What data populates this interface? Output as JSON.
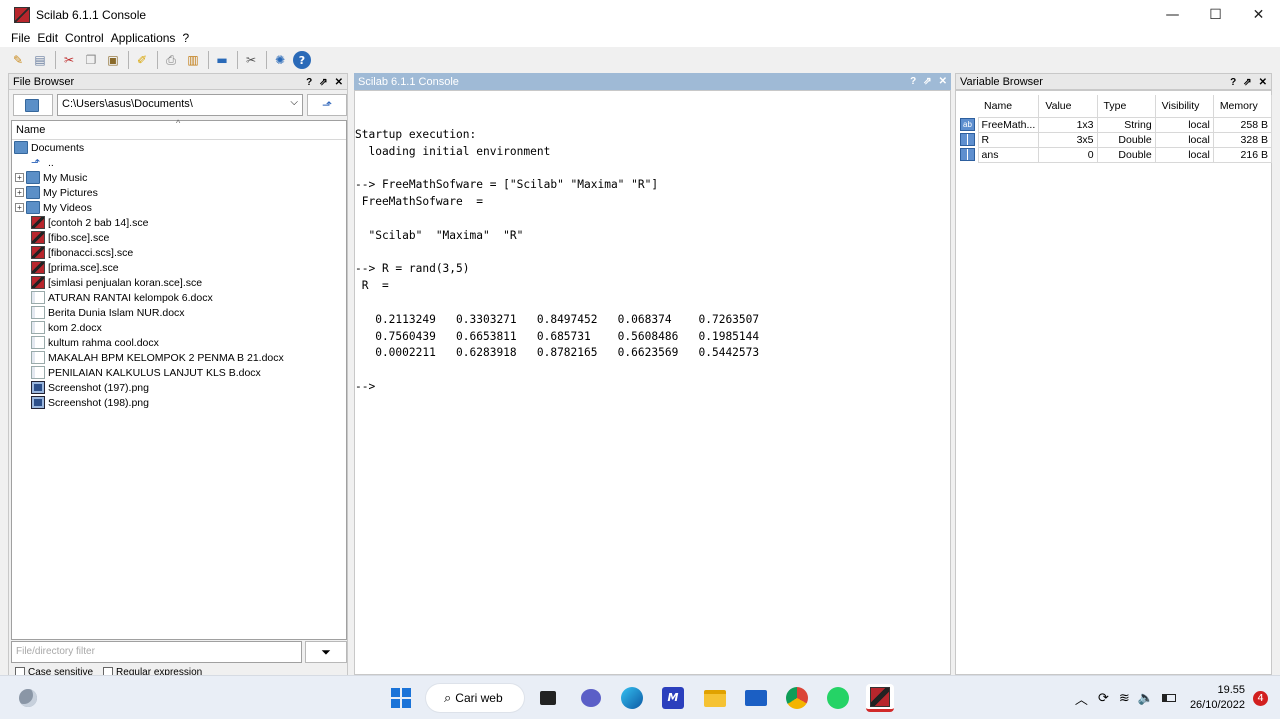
{
  "window": {
    "title": "Scilab 6.1.1 Console",
    "minimize": "—",
    "maximize": "☐",
    "close": "✕"
  },
  "menu": [
    "File",
    "Edit",
    "Control",
    "Applications",
    "?"
  ],
  "toolbar_icons": [
    "new-script-icon",
    "open-file-icon",
    "cut-icon",
    "copy-icon",
    "paste-icon",
    "clear-icon",
    "print-icon",
    "preferences-icon",
    "console-icon",
    "tools-icon",
    "modules-icon",
    "help-icon"
  ],
  "file_browser": {
    "title": "File Browser",
    "controls": [
      "?",
      "⇗",
      "✕"
    ],
    "path": "C:\\Users\\asus\\Documents\\",
    "column_name": "Name",
    "root": "Documents",
    "items": [
      {
        "label": "..",
        "type": "up",
        "expandable": false
      },
      {
        "label": "My Music",
        "type": "folder",
        "expandable": true
      },
      {
        "label": "My Pictures",
        "type": "folder",
        "expandable": true
      },
      {
        "label": "My Videos",
        "type": "folder",
        "expandable": true
      },
      {
        "label": "[contoh 2 bab 14].sce",
        "type": "sce",
        "expandable": false
      },
      {
        "label": "[fibo.sce].sce",
        "type": "sce",
        "expandable": false
      },
      {
        "label": "[fibonacci.scs].sce",
        "type": "sce",
        "expandable": false
      },
      {
        "label": "[prima.sce].sce",
        "type": "sce",
        "expandable": false
      },
      {
        "label": "[simlasi penjualan koran.sce].sce",
        "type": "sce",
        "expandable": false
      },
      {
        "label": "ATURAN RANTAI kelompok 6.docx",
        "type": "doc",
        "expandable": false
      },
      {
        "label": "Berita Dunia Islam NUR.docx",
        "type": "doc",
        "expandable": false
      },
      {
        "label": "kom 2.docx",
        "type": "doc",
        "expandable": false
      },
      {
        "label": "kultum rahma cool.docx",
        "type": "doc",
        "expandable": false
      },
      {
        "label": "MAKALAH BPM KELOMPOK 2 PENMA B 21.docx",
        "type": "doc",
        "expandable": false
      },
      {
        "label": "PENILAIAN KALKULUS LANJUT KLS B.docx",
        "type": "doc",
        "expandable": false
      },
      {
        "label": "Screenshot (197).png",
        "type": "png",
        "expandable": false
      },
      {
        "label": "Screenshot (198).png",
        "type": "png",
        "expandable": false
      }
    ],
    "filter_placeholder": "File/directory filter",
    "case_sensitive": "Case sensitive",
    "regular_expression": "Regular expression"
  },
  "console": {
    "title": "Scilab 6.1.1 Console",
    "controls": [
      "?",
      "⇗",
      "✕"
    ],
    "lines": [
      "Startup execution:",
      "  loading initial environment",
      "",
      "--> FreeMathSofware = [\"Scilab\" \"Maxima\" \"R\"]",
      " FreeMathSofware  =",
      "",
      "  \"Scilab\"  \"Maxima\"  \"R\"",
      "",
      "--> R = rand(3,5)",
      " R  =",
      "",
      "   0.2113249   0.3303271   0.8497452   0.068374    0.7263507",
      "   0.7560439   0.6653811   0.685731    0.5608486   0.1985144",
      "   0.0002211   0.6283918   0.8782165   0.6623569   0.5442573",
      "",
      "-->"
    ]
  },
  "variable_browser": {
    "title": "Variable Browser",
    "controls": [
      "?",
      "⇗",
      "✕"
    ],
    "columns": [
      "Name",
      "Value",
      "Type",
      "Visibility",
      "Memory"
    ],
    "rows": [
      {
        "icon": "ab",
        "name": "FreeMath...",
        "value": "1x3",
        "type": "String",
        "visibility": "local",
        "memory": "258 B"
      },
      {
        "icon": "grid",
        "name": "R",
        "value": "3x5",
        "type": "Double",
        "visibility": "local",
        "memory": "328 B"
      },
      {
        "icon": "grid",
        "name": "ans",
        "value": "0",
        "type": "Double",
        "visibility": "local",
        "memory": "216 B"
      }
    ]
  },
  "taskbar": {
    "search_label": "Cari web",
    "time": "19.55",
    "date": "26/10/2022",
    "notifications": "4"
  }
}
